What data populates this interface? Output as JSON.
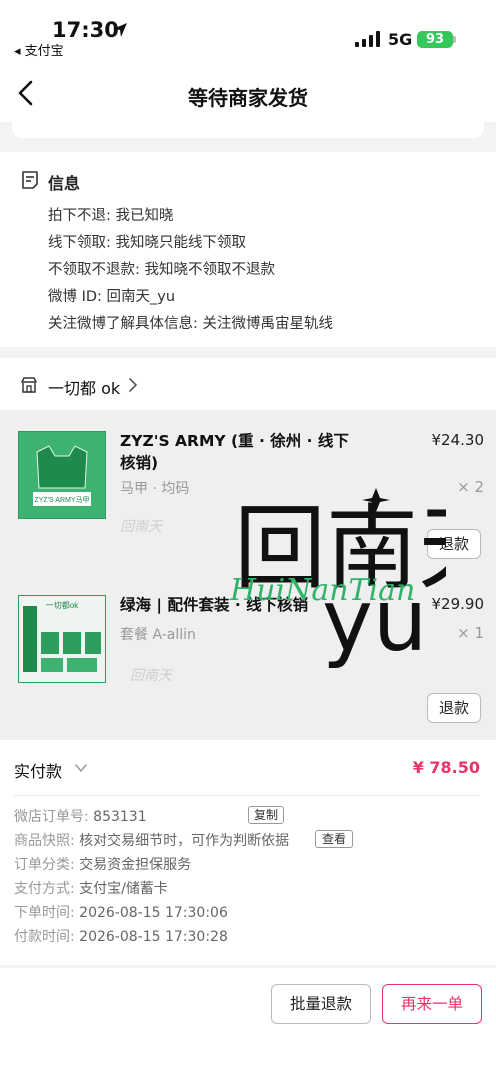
{
  "status_bar": {
    "time": "17:30",
    "back_app": "◂ 支付宝",
    "network": "5G",
    "battery": "93"
  },
  "nav": {
    "title": "等待商家发货"
  },
  "info": {
    "title": "信息",
    "lines": [
      "拍下不退: 我已知晓",
      "线下领取: 我知晓只能线下领取",
      "不领取不退款: 我知晓不领取不退款",
      "微博 ID: 回南天_yu",
      "关注微博了解具体信息: 关注微博禹宙星轨线"
    ]
  },
  "shop": {
    "name": "一切都 ok"
  },
  "items": [
    {
      "title": "ZYZ'S ARMY (重 · 徐州 · 线下核销)",
      "spec": "马甲 · 均码",
      "price": "¥24.30",
      "qty": "× 2",
      "refund_label": "退款",
      "thumb_text": "ZYZ'S ARMY马甲"
    },
    {
      "title": "绿海 | 配件套装 · 线下核销",
      "spec": "套餐 A-allin",
      "price": "¥29.90",
      "qty": "× 1",
      "refund_label": "退款",
      "thumb_text": "一切都ok"
    }
  ],
  "watermark": {
    "chinese": "回南天",
    "latin": "yu",
    "script": "HuiNanTian"
  },
  "payment": {
    "label": "实付款",
    "amount": "¥ 78.50"
  },
  "order": {
    "rows": [
      {
        "label": "微店订单号:",
        "value": "853131"
      },
      {
        "label": "商品快照:",
        "value": "核对交易细节时，可作为判断依据"
      },
      {
        "label": "订单分类:",
        "value": "交易资金担保服务"
      },
      {
        "label": "支付方式:",
        "value": "支付宝/储蓄卡"
      },
      {
        "label": "下单时间:",
        "value": "2026-08-15 17:30:06"
      },
      {
        "label": "付款时间:",
        "value": "2026-08-15 17:30:28"
      }
    ],
    "copy_label": "复制",
    "view_label": "查看"
  },
  "actions": {
    "batch_refund": "批量退款",
    "buy_again": "再来一单"
  },
  "colors": {
    "accent": "#e8356a",
    "battery": "#34c759",
    "thumb_green": "#3cb371"
  }
}
